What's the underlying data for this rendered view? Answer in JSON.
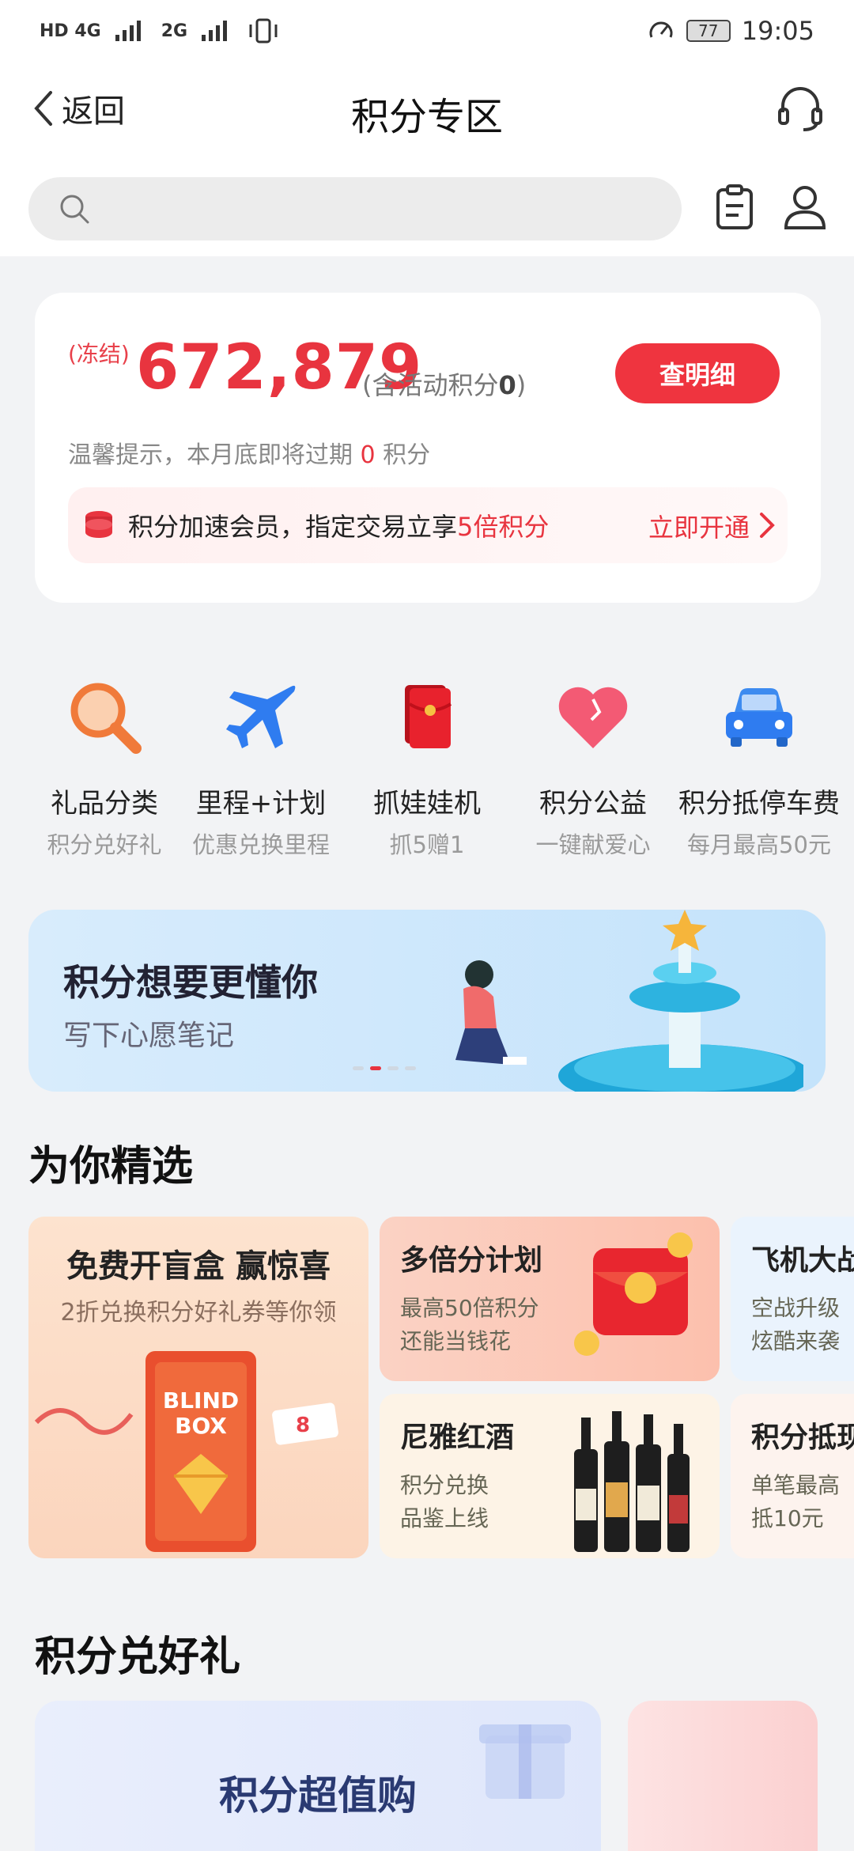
{
  "status_bar": {
    "network": "HD 4G",
    "network2": "2G",
    "battery": "77",
    "time": "19:05"
  },
  "nav": {
    "back_label": "返回",
    "title": "积分专区"
  },
  "search": {
    "placeholder": ""
  },
  "points": {
    "frozen_label": "(冻结)",
    "value": "672,879",
    "activity_prefix": "(含活动积分",
    "activity_value": "0",
    "activity_suffix": ")",
    "detail_button": "查明细",
    "tip_prefix": "温馨提示，本月底即将过期 ",
    "tip_value": "0",
    "tip_suffix": " 积分"
  },
  "vip": {
    "text_prefix": "积分加速会员，指定交易立享",
    "text_highlight": "5倍积分",
    "open_label": "立即开通"
  },
  "quick_entries": [
    {
      "title": "礼品分类",
      "subtitle": "积分兑好礼",
      "icon": "magnifier-icon"
    },
    {
      "title": "里程+计划",
      "subtitle": "优惠兑换里程",
      "icon": "airplane-icon"
    },
    {
      "title": "抓娃娃机",
      "subtitle": "抓5赠1",
      "icon": "red-envelope-icon"
    },
    {
      "title": "积分公益",
      "subtitle": "一键献爱心",
      "icon": "heart-icon"
    },
    {
      "title": "积分抵停车费",
      "subtitle": "每月最高50元",
      "icon": "car-icon"
    }
  ],
  "banner": {
    "title": "积分想要更懂你",
    "subtitle": "写下心愿笔记"
  },
  "picks": {
    "section_title": "为你精选",
    "big": {
      "title": "免费开盲盒 赢惊喜",
      "subtitle": "2折兑换积分好礼券等你领",
      "box_text_1": "BLIND",
      "box_text_2": "BOX"
    },
    "cards": [
      {
        "title": "多倍分计划",
        "sub1": "最高50倍积分",
        "sub2": "还能当钱花"
      },
      {
        "title": "尼雅红酒",
        "sub1": "积分兑换",
        "sub2": "品鉴上线"
      },
      {
        "title": "飞机大战",
        "sub1": "空战升级",
        "sub2": "炫酷来袭"
      },
      {
        "title": "积分抵现",
        "sub1": "单笔最高",
        "sub2": "抵10元"
      }
    ]
  },
  "gifts": {
    "section_title": "积分兑好礼",
    "card_title": "积分超值购"
  },
  "colors": {
    "accent_red": "#ef343f",
    "page_bg": "#f2f3f5"
  }
}
